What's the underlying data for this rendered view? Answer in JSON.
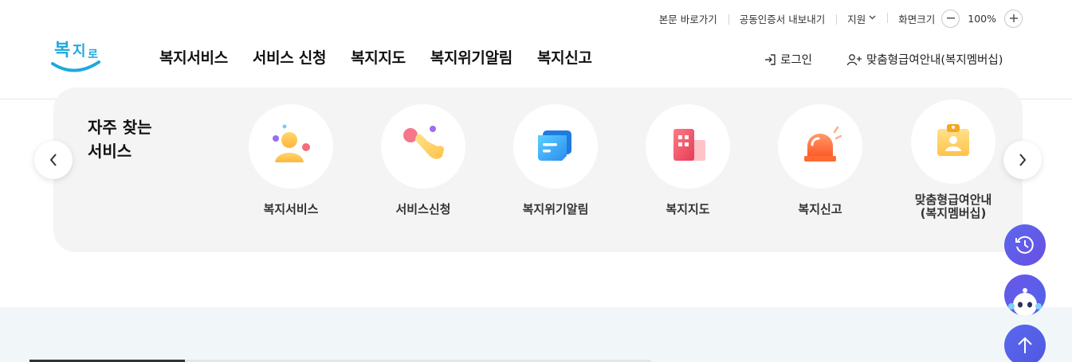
{
  "utility": {
    "skip": "본문 바로가기",
    "cert": "공동인증서 내보내기",
    "support": "지원",
    "zoom_label": "화면크기",
    "zoom_value": "100%"
  },
  "logo": {
    "text": "복지로"
  },
  "gnb": [
    {
      "label": "복지서비스"
    },
    {
      "label": "서비스 신청"
    },
    {
      "label": "복지지도"
    },
    {
      "label": "복지위기알림"
    },
    {
      "label": "복지신고"
    }
  ],
  "header": {
    "login": "로그인",
    "member": "맞춤형급여안내(복지멤버십)"
  },
  "frequent": {
    "title": "자주 찾는\n서비스",
    "items": [
      {
        "label": "복지서비스",
        "icon": "person-bubbles-icon"
      },
      {
        "label": "서비스신청",
        "icon": "hand-pointer-icon"
      },
      {
        "label": "복지위기알림",
        "icon": "message-card-icon"
      },
      {
        "label": "복지지도",
        "icon": "building-map-icon"
      },
      {
        "label": "복지신고",
        "icon": "siren-icon"
      },
      {
        "label": "맞춤형급여안내\n(복지멤버십)",
        "icon": "id-badge-icon"
      }
    ]
  },
  "colors": {
    "accent": "#5a63ea",
    "brand_blue": "#1fa8e0"
  }
}
